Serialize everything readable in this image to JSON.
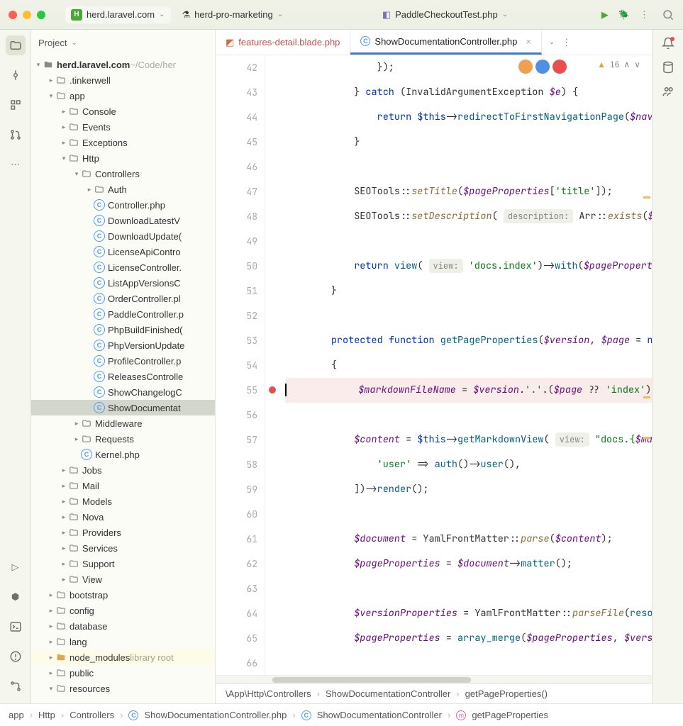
{
  "title": {
    "projects": [
      {
        "name": "herd.laravel.com",
        "icon": "H",
        "active": true
      },
      {
        "name": "herd-pro-marketing",
        "icon": "",
        "active": false
      }
    ],
    "file": "PaddleCheckoutTest.php"
  },
  "project_hdr": "Project",
  "warnings": "16",
  "tree": {
    "root": {
      "name": "herd.laravel.com",
      "path": "~/Code/her"
    },
    "items": [
      {
        "d": 1,
        "t": "f",
        "n": ".tinkerwell",
        "c": true
      },
      {
        "d": 1,
        "t": "f",
        "n": "app",
        "c": false
      },
      {
        "d": 2,
        "t": "f",
        "n": "Console",
        "c": true
      },
      {
        "d": 2,
        "t": "f",
        "n": "Events",
        "c": true
      },
      {
        "d": 2,
        "t": "f",
        "n": "Exceptions",
        "c": true
      },
      {
        "d": 2,
        "t": "f",
        "n": "Http",
        "c": false
      },
      {
        "d": 3,
        "t": "f",
        "n": "Controllers",
        "c": false
      },
      {
        "d": 4,
        "t": "f",
        "n": "Auth",
        "c": true
      },
      {
        "d": 4,
        "t": "p",
        "n": "Controller.php"
      },
      {
        "d": 4,
        "t": "p",
        "n": "DownloadLatestV"
      },
      {
        "d": 4,
        "t": "p",
        "n": "DownloadUpdate("
      },
      {
        "d": 4,
        "t": "p",
        "n": "LicenseApiContro"
      },
      {
        "d": 4,
        "t": "p",
        "n": "LicenseController."
      },
      {
        "d": 4,
        "t": "p",
        "n": "ListAppVersionsC"
      },
      {
        "d": 4,
        "t": "p",
        "n": "OrderController.pl"
      },
      {
        "d": 4,
        "t": "p",
        "n": "PaddleController.p"
      },
      {
        "d": 4,
        "t": "p",
        "n": "PhpBuildFinished("
      },
      {
        "d": 4,
        "t": "p",
        "n": "PhpVersionUpdate"
      },
      {
        "d": 4,
        "t": "p",
        "n": "ProfileController.p"
      },
      {
        "d": 4,
        "t": "p",
        "n": "ReleasesControlle"
      },
      {
        "d": 4,
        "t": "p",
        "n": "ShowChangelogC"
      },
      {
        "d": 4,
        "t": "p",
        "n": "ShowDocumentat",
        "sel": true
      },
      {
        "d": 3,
        "t": "f",
        "n": "Middleware",
        "c": true
      },
      {
        "d": 3,
        "t": "f",
        "n": "Requests",
        "c": true
      },
      {
        "d": 3,
        "t": "p",
        "n": "Kernel.php"
      },
      {
        "d": 2,
        "t": "f",
        "n": "Jobs",
        "c": true
      },
      {
        "d": 2,
        "t": "f",
        "n": "Mail",
        "c": true
      },
      {
        "d": 2,
        "t": "f",
        "n": "Models",
        "c": true
      },
      {
        "d": 2,
        "t": "f",
        "n": "Nova",
        "c": true
      },
      {
        "d": 2,
        "t": "f",
        "n": "Providers",
        "c": true
      },
      {
        "d": 2,
        "t": "f",
        "n": "Services",
        "c": true
      },
      {
        "d": 2,
        "t": "f",
        "n": "Support",
        "c": true
      },
      {
        "d": 2,
        "t": "f",
        "n": "View",
        "c": true
      },
      {
        "d": 1,
        "t": "f",
        "n": "bootstrap",
        "c": true
      },
      {
        "d": 1,
        "t": "f",
        "n": "config",
        "c": true
      },
      {
        "d": 1,
        "t": "f",
        "n": "database",
        "c": true
      },
      {
        "d": 1,
        "t": "f",
        "n": "lang",
        "c": true
      },
      {
        "d": 1,
        "t": "fo",
        "n": "node_modules",
        "c": true,
        "lib": "library root",
        "excl": true
      },
      {
        "d": 1,
        "t": "f",
        "n": "public",
        "c": true
      },
      {
        "d": 1,
        "t": "f",
        "n": "resources",
        "c": false
      }
    ]
  },
  "tabs": [
    {
      "label": "features-detail.blade.php",
      "mod": true,
      "active": false
    },
    {
      "label": "ShowDocumentationController.php",
      "mod": false,
      "active": true
    }
  ],
  "code": {
    "start": 42,
    "lines": [
      {
        "n": 42,
        "seg": [
          {
            "t": "                });",
            "c": ""
          }
        ]
      },
      {
        "n": 43,
        "seg": [
          {
            "t": "            } ",
            "c": ""
          },
          {
            "t": "catch",
            "c": "k"
          },
          {
            "t": " (InvalidArgumentException ",
            "c": ""
          },
          {
            "t": "$e",
            "c": "v"
          },
          {
            "t": ") {",
            "c": ""
          }
        ]
      },
      {
        "n": 44,
        "seg": [
          {
            "t": "                ",
            "c": ""
          },
          {
            "t": "return",
            "c": "k"
          },
          {
            "t": " ",
            "c": ""
          },
          {
            "t": "$this",
            "c": "k"
          },
          {
            "t": "->",
            "c": ""
          },
          {
            "t": "redirectToFirstNavigationPage",
            "c": "fn"
          },
          {
            "t": "(",
            "c": ""
          },
          {
            "t": "$navig",
            "c": "v"
          }
        ]
      },
      {
        "n": 45,
        "seg": [
          {
            "t": "            }",
            "c": ""
          }
        ]
      },
      {
        "n": 46,
        "seg": [
          {
            "t": "",
            "c": ""
          }
        ]
      },
      {
        "n": 47,
        "seg": [
          {
            "t": "            SEOTools::",
            "c": ""
          },
          {
            "t": "setTitle",
            "c": "m"
          },
          {
            "t": "(",
            "c": ""
          },
          {
            "t": "$pageProperties",
            "c": "v"
          },
          {
            "t": "[",
            "c": ""
          },
          {
            "t": "'title'",
            "c": "s"
          },
          {
            "t": "]);",
            "c": ""
          }
        ]
      },
      {
        "n": 48,
        "seg": [
          {
            "t": "            SEOTools::",
            "c": ""
          },
          {
            "t": "setDescription",
            "c": "m"
          },
          {
            "t": "( ",
            "c": ""
          },
          {
            "t": "description:",
            "c": "hint"
          },
          {
            "t": " Arr::",
            "c": ""
          },
          {
            "t": "exists",
            "c": "m"
          },
          {
            "t": "(",
            "c": ""
          },
          {
            "t": "$pageP",
            "c": "v"
          }
        ]
      },
      {
        "n": 49,
        "seg": [
          {
            "t": "",
            "c": ""
          }
        ]
      },
      {
        "n": 50,
        "seg": [
          {
            "t": "            ",
            "c": ""
          },
          {
            "t": "return",
            "c": "k"
          },
          {
            "t": " ",
            "c": ""
          },
          {
            "t": "view",
            "c": "fn"
          },
          {
            "t": "( ",
            "c": ""
          },
          {
            "t": "view:",
            "c": "hint"
          },
          {
            "t": " ",
            "c": ""
          },
          {
            "t": "'docs.index'",
            "c": "s"
          },
          {
            "t": ")->",
            "c": ""
          },
          {
            "t": "with",
            "c": "fn"
          },
          {
            "t": "(",
            "c": ""
          },
          {
            "t": "$pageProperties",
            "c": "v"
          },
          {
            "t": ")",
            "c": ""
          }
        ]
      },
      {
        "n": 51,
        "seg": [
          {
            "t": "        }",
            "c": ""
          }
        ]
      },
      {
        "n": 52,
        "seg": [
          {
            "t": "",
            "c": ""
          }
        ]
      },
      {
        "n": 53,
        "seg": [
          {
            "t": "        ",
            "c": ""
          },
          {
            "t": "protected",
            "c": "k"
          },
          {
            "t": " ",
            "c": ""
          },
          {
            "t": "function",
            "c": "k"
          },
          {
            "t": " ",
            "c": ""
          },
          {
            "t": "getPageProperties",
            "c": "fn"
          },
          {
            "t": "(",
            "c": ""
          },
          {
            "t": "$version",
            "c": "v"
          },
          {
            "t": ", ",
            "c": ""
          },
          {
            "t": "$page",
            "c": "v"
          },
          {
            "t": " = ",
            "c": ""
          },
          {
            "t": "nul",
            "c": "k"
          }
        ]
      },
      {
        "n": 54,
        "seg": [
          {
            "t": "        {",
            "c": ""
          }
        ]
      },
      {
        "n": 55,
        "bp": true,
        "seg": [
          {
            "t": "            ",
            "c": ""
          },
          {
            "t": "$markdownFileName",
            "c": "v"
          },
          {
            "t": " = ",
            "c": ""
          },
          {
            "t": "$version",
            "c": "v"
          },
          {
            "t": ".",
            "c": ""
          },
          {
            "t": "'.'",
            "c": "s"
          },
          {
            "t": ".(",
            "c": ""
          },
          {
            "t": "$page",
            "c": "v"
          },
          {
            "t": " ?? ",
            "c": ""
          },
          {
            "t": "'index'",
            "c": "s"
          },
          {
            "t": ");",
            "c": ""
          }
        ]
      },
      {
        "n": 56,
        "seg": [
          {
            "t": "",
            "c": ""
          }
        ]
      },
      {
        "n": 57,
        "seg": [
          {
            "t": "            ",
            "c": ""
          },
          {
            "t": "$content",
            "c": "v"
          },
          {
            "t": " = ",
            "c": ""
          },
          {
            "t": "$this",
            "c": "k"
          },
          {
            "t": "->",
            "c": ""
          },
          {
            "t": "getMarkdownView",
            "c": "fn"
          },
          {
            "t": "( ",
            "c": ""
          },
          {
            "t": "view:",
            "c": "hint"
          },
          {
            "t": " ",
            "c": ""
          },
          {
            "t": "\"docs.{",
            "c": "s"
          },
          {
            "t": "$markdo",
            "c": "v"
          }
        ]
      },
      {
        "n": 58,
        "seg": [
          {
            "t": "                ",
            "c": ""
          },
          {
            "t": "'user'",
            "c": "s"
          },
          {
            "t": " => ",
            "c": ""
          },
          {
            "t": "auth",
            "c": "fn"
          },
          {
            "t": "()->",
            "c": ""
          },
          {
            "t": "user",
            "c": "fn"
          },
          {
            "t": "(),",
            "c": ""
          }
        ]
      },
      {
        "n": 59,
        "seg": [
          {
            "t": "            ])->",
            "c": ""
          },
          {
            "t": "render",
            "c": "fn"
          },
          {
            "t": "();",
            "c": ""
          }
        ]
      },
      {
        "n": 60,
        "seg": [
          {
            "t": "",
            "c": ""
          }
        ]
      },
      {
        "n": 61,
        "seg": [
          {
            "t": "            ",
            "c": ""
          },
          {
            "t": "$document",
            "c": "v"
          },
          {
            "t": " = YamlFrontMatter::",
            "c": ""
          },
          {
            "t": "parse",
            "c": "m"
          },
          {
            "t": "(",
            "c": ""
          },
          {
            "t": "$content",
            "c": "v"
          },
          {
            "t": ");",
            "c": ""
          }
        ]
      },
      {
        "n": 62,
        "seg": [
          {
            "t": "            ",
            "c": ""
          },
          {
            "t": "$pageProperties",
            "c": "v"
          },
          {
            "t": " = ",
            "c": ""
          },
          {
            "t": "$document",
            "c": "v"
          },
          {
            "t": "->",
            "c": ""
          },
          {
            "t": "matter",
            "c": "fn"
          },
          {
            "t": "();",
            "c": ""
          }
        ]
      },
      {
        "n": 63,
        "seg": [
          {
            "t": "",
            "c": ""
          }
        ]
      },
      {
        "n": 64,
        "seg": [
          {
            "t": "            ",
            "c": ""
          },
          {
            "t": "$versionProperties",
            "c": "v"
          },
          {
            "t": " = YamlFrontMatter::",
            "c": ""
          },
          {
            "t": "parseFile",
            "c": "m"
          },
          {
            "t": "(",
            "c": ""
          },
          {
            "t": "resour",
            "c": "fn"
          }
        ]
      },
      {
        "n": 65,
        "seg": [
          {
            "t": "            ",
            "c": ""
          },
          {
            "t": "$pageProperties",
            "c": "v"
          },
          {
            "t": " = ",
            "c": ""
          },
          {
            "t": "array_merge",
            "c": "fn"
          },
          {
            "t": "(",
            "c": ""
          },
          {
            "t": "$pageProperties",
            "c": "v"
          },
          {
            "t": ", ",
            "c": ""
          },
          {
            "t": "$versio",
            "c": "v"
          }
        ]
      },
      {
        "n": 66,
        "seg": [
          {
            "t": "",
            "c": ""
          }
        ]
      }
    ]
  },
  "editor_crumb": [
    "\\App\\Http\\Controllers",
    "ShowDocumentationController",
    "getPageProperties()"
  ],
  "bottom_crumb": [
    {
      "t": "app"
    },
    {
      "t": "Http"
    },
    {
      "t": "Controllers"
    },
    {
      "t": "ShowDocumentationController.php",
      "i": "c"
    },
    {
      "t": "ShowDocumentationController",
      "i": "c"
    },
    {
      "t": "getPageProperties",
      "i": "m"
    }
  ]
}
